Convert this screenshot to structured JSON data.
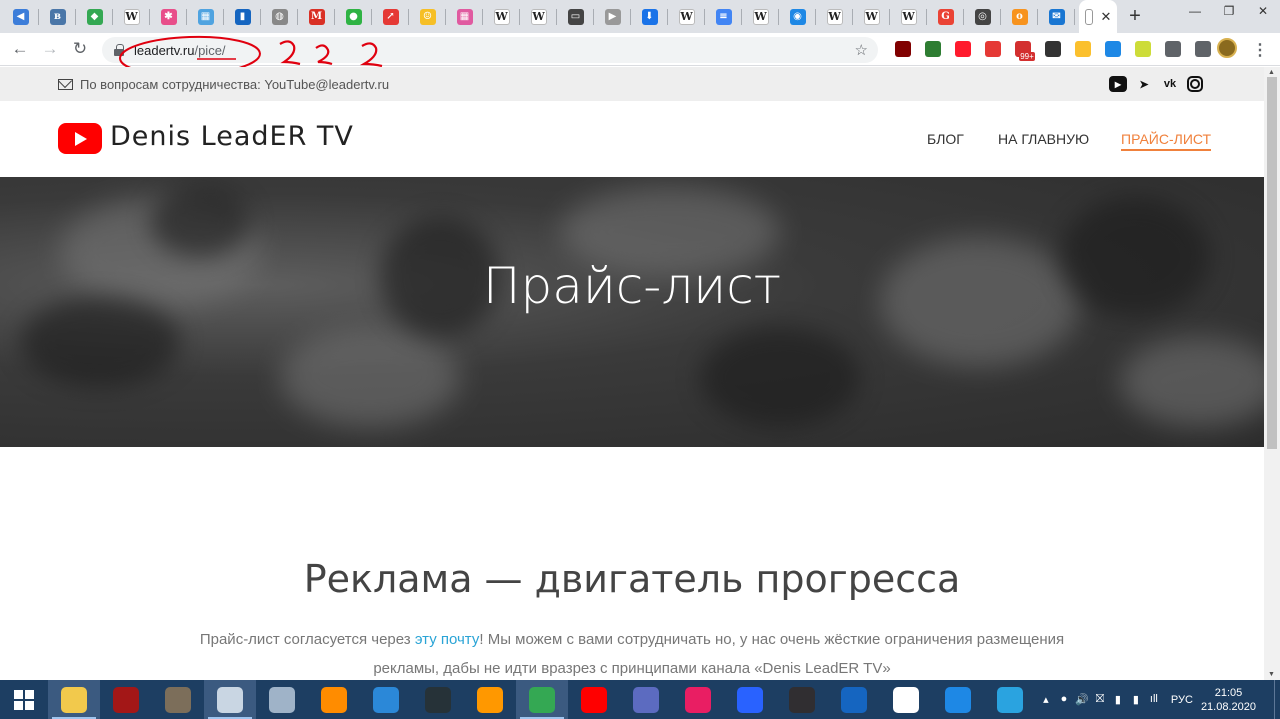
{
  "browser": {
    "active_tab_close": "✕",
    "new_tab": "+",
    "window_controls": {
      "minimize": "—",
      "restore": "❐",
      "close": "✕"
    },
    "nav": {
      "back": "←",
      "forward": "→",
      "reload": "↻"
    },
    "url_host": "leadertv.ru",
    "url_path": "/pice/",
    "bookmark_star": "☆",
    "ext_badge": "99+",
    "menu": "⋮",
    "tabs": [
      {
        "icon": "mute-icon",
        "color": "#3c7dd9",
        "label": "◀"
      },
      {
        "icon": "vk-icon",
        "color": "#4a76a8",
        "label": "в"
      },
      {
        "icon": "maps-icon",
        "color": "#34a853",
        "label": "◆"
      },
      {
        "icon": "wikipedia-icon",
        "color": "#fff",
        "label": "W"
      },
      {
        "icon": "pinwheel-icon",
        "color": "#e84e8a",
        "label": "✱"
      },
      {
        "icon": "grid-icon",
        "color": "#4fa3e0",
        "label": "▦"
      },
      {
        "icon": "bag-icon",
        "color": "#1565c0",
        "label": "▮"
      },
      {
        "icon": "badge-icon",
        "color": "#888888",
        "label": "◍"
      },
      {
        "icon": "gmail-icon",
        "color": "#d93025",
        "label": "M"
      },
      {
        "icon": "green-dot-icon",
        "color": "#2fb344",
        "label": "●"
      },
      {
        "icon": "chart-arrow-icon",
        "color": "#e53935",
        "label": "↗"
      },
      {
        "icon": "sticker-icon",
        "color": "#f6bf26",
        "label": "☺"
      },
      {
        "icon": "apps-icon",
        "color": "#e05aa0",
        "label": "▦"
      },
      {
        "icon": "wikipedia-icon",
        "color": "#fff",
        "label": "W"
      },
      {
        "icon": "wikipedia-icon",
        "color": "#fff",
        "label": "W"
      },
      {
        "icon": "screen-icon",
        "color": "#444444",
        "label": "▭"
      },
      {
        "icon": "play-icon",
        "color": "#999999",
        "label": "▶"
      },
      {
        "icon": "download-icon",
        "color": "#1a73e8",
        "label": "⬇"
      },
      {
        "icon": "wikipedia-icon",
        "color": "#fff",
        "label": "W"
      },
      {
        "icon": "docs-icon",
        "color": "#4285f4",
        "label": "≡"
      },
      {
        "icon": "wikipedia-icon",
        "color": "#fff",
        "label": "W"
      },
      {
        "icon": "globe-icon",
        "color": "#1e88e5",
        "label": "◉"
      },
      {
        "icon": "wikipedia-icon",
        "color": "#fff",
        "label": "W"
      },
      {
        "icon": "wikipedia-icon",
        "color": "#fff",
        "label": "W"
      },
      {
        "icon": "wikipedia-icon",
        "color": "#fff",
        "label": "W"
      },
      {
        "icon": "google-icon",
        "color": "#ea4335",
        "label": "G"
      },
      {
        "icon": "target-icon",
        "color": "#444444",
        "label": "◎"
      },
      {
        "icon": "ok-icon",
        "color": "#f7931e",
        "label": "о"
      },
      {
        "icon": "mail-tab-icon",
        "color": "#1976d2",
        "label": "✉"
      }
    ],
    "extensions": [
      {
        "icon": "ublock-icon",
        "color": "#800000"
      },
      {
        "icon": "s-ext-icon",
        "color": "#2e7d32"
      },
      {
        "icon": "opera-icon",
        "color": "#ff1b2d"
      },
      {
        "icon": "block-icon",
        "color": "#e53935"
      },
      {
        "icon": "badge-ext-icon",
        "color": "#d32f2f"
      },
      {
        "icon": "dots-ext-icon",
        "color": "#333333"
      },
      {
        "icon": "yellow-ext-icon",
        "color": "#fbc02d"
      },
      {
        "icon": "acrobat-icon",
        "color": "#1e88e5"
      },
      {
        "icon": "pattern-ext-icon",
        "color": "#cddc39"
      },
      {
        "icon": "puzzle-icon",
        "color": "#5f6368"
      },
      {
        "icon": "reading-list-icon",
        "color": "#5f6368"
      }
    ]
  },
  "site": {
    "contact_text": "По вопросам сотрудничества: YouTube@leadertv.ru",
    "socials": {
      "youtube": "▶",
      "telegram": "➤",
      "vk": "vk",
      "instagram": ""
    },
    "logo_text": "Denis LeadER TV",
    "nav": {
      "blog": "БЛОГ",
      "home": "НА ГЛАВНУЮ",
      "price": "ПРАЙС-ЛИСТ"
    },
    "hero_title": "Прайс-лист",
    "section_title": "Реклама — двигатель прогресса",
    "para_before_link": "Прайс-лист согласуется через ",
    "para_link": "эту почту",
    "para_after_link": "! Мы можем с вами сотрудничать но, у нас очень жёсткие ограничения размещения рекламы, дабы не идти вразрез с принципами канала «Denis LeadER TV»"
  },
  "annotation": {
    "question_marks": "? ? ?",
    "color": "#e0000f"
  },
  "taskbar": {
    "apps": [
      {
        "icon": "file-explorer-icon",
        "color": "#f2c94c",
        "active": true
      },
      {
        "icon": "app-red-icon",
        "color": "#a31717"
      },
      {
        "icon": "gimp-icon",
        "color": "#7c6e5a"
      },
      {
        "icon": "magnifier-icon",
        "color": "#c9d6e3",
        "active": true
      },
      {
        "icon": "monitor-icon",
        "color": "#9fb3c8"
      },
      {
        "icon": "media-player-icon",
        "color": "#ff8c00"
      },
      {
        "icon": "browser-icon",
        "color": "#2b88d8"
      },
      {
        "icon": "calendar-321-icon",
        "color": "#263238"
      },
      {
        "icon": "sublime-icon",
        "color": "#ff9800"
      },
      {
        "icon": "chrome-icon",
        "color": "#34a853",
        "active": true
      },
      {
        "icon": "yandex-icon",
        "color": "#ff0000"
      },
      {
        "icon": "calculator-icon",
        "color": "#5c6bc0"
      },
      {
        "icon": "ball-icon",
        "color": "#e91e63"
      },
      {
        "icon": "headset-icon",
        "color": "#2962ff"
      },
      {
        "icon": "obs-icon",
        "color": "#302e31"
      },
      {
        "icon": "virtualbox-icon",
        "color": "#1565c0"
      },
      {
        "icon": "yandex-browser-icon",
        "color": "#ffffff"
      },
      {
        "icon": "wps-icon",
        "color": "#1e88e5"
      },
      {
        "icon": "telegram-icon",
        "color": "#2aa3e0"
      }
    ],
    "tray_icons": [
      "▴",
      "●",
      "🔊",
      "⛝",
      "▮",
      "▮",
      "ıll"
    ],
    "lang": "РУС",
    "time": "21:05",
    "date": "21.08.2020"
  }
}
